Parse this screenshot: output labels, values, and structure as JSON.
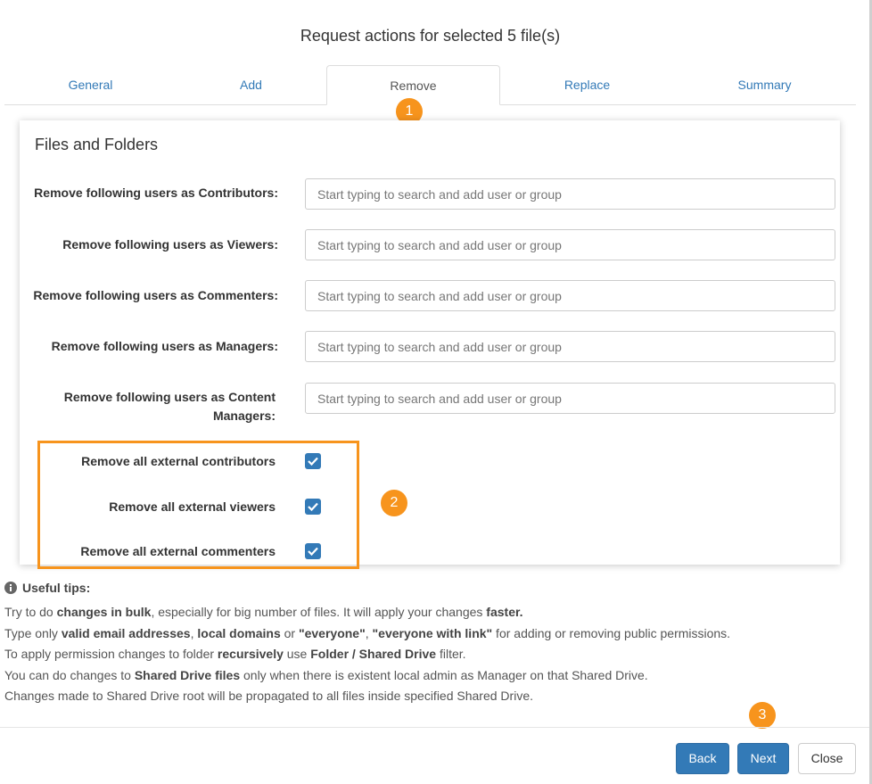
{
  "modal": {
    "title": "Request actions for selected 5 file(s)"
  },
  "tabs": [
    {
      "label": "General"
    },
    {
      "label": "Add"
    },
    {
      "label": "Remove"
    },
    {
      "label": "Replace"
    },
    {
      "label": "Summary"
    }
  ],
  "badges": [
    "1",
    "2",
    "3"
  ],
  "panel": {
    "title": "Files and Folders",
    "placeholder": "Start typing to search and add user or group",
    "rows": [
      {
        "label": "Remove following users as Contributors:"
      },
      {
        "label": "Remove following users as Viewers:"
      },
      {
        "label": "Remove following users as Commenters:"
      },
      {
        "label": "Remove following users as Managers:"
      },
      {
        "label": "Remove following users as Content Managers:"
      }
    ],
    "checkboxes": [
      {
        "label": "Remove all external contributors",
        "checked": true
      },
      {
        "label": "Remove all external viewers",
        "checked": true
      },
      {
        "label": "Remove all external commenters",
        "checked": true
      }
    ]
  },
  "tips": {
    "heading": "Useful tips:",
    "line1": {
      "a": "Try to do ",
      "b": "changes in bulk",
      "c": ", especially for big number of files. It will apply your changes ",
      "d": "faster."
    },
    "line2": {
      "a": "Type only ",
      "b": "valid email addresses",
      "c": ", ",
      "d": "local domains",
      "e": " or ",
      "f": "\"everyone\"",
      "g": ", ",
      "h": "\"everyone with link\"",
      "i": " for adding or removing public permissions."
    },
    "line3": {
      "a": "To apply permission changes to folder ",
      "b": "recursively",
      "c": " use ",
      "d": "Folder / Shared Drive",
      "e": " filter."
    },
    "line4": {
      "a": "You can do changes to ",
      "b": "Shared Drive files",
      "c": " only when there is existent local admin as Manager on that Shared Drive."
    },
    "line5": "Changes made to Shared Drive root will be propagated to all files inside specified Shared Drive."
  },
  "footer": {
    "back": "Back",
    "next": "Next",
    "close": "Close"
  },
  "colors": {
    "accent": "#337ab7",
    "highlight": "#f7941d"
  }
}
